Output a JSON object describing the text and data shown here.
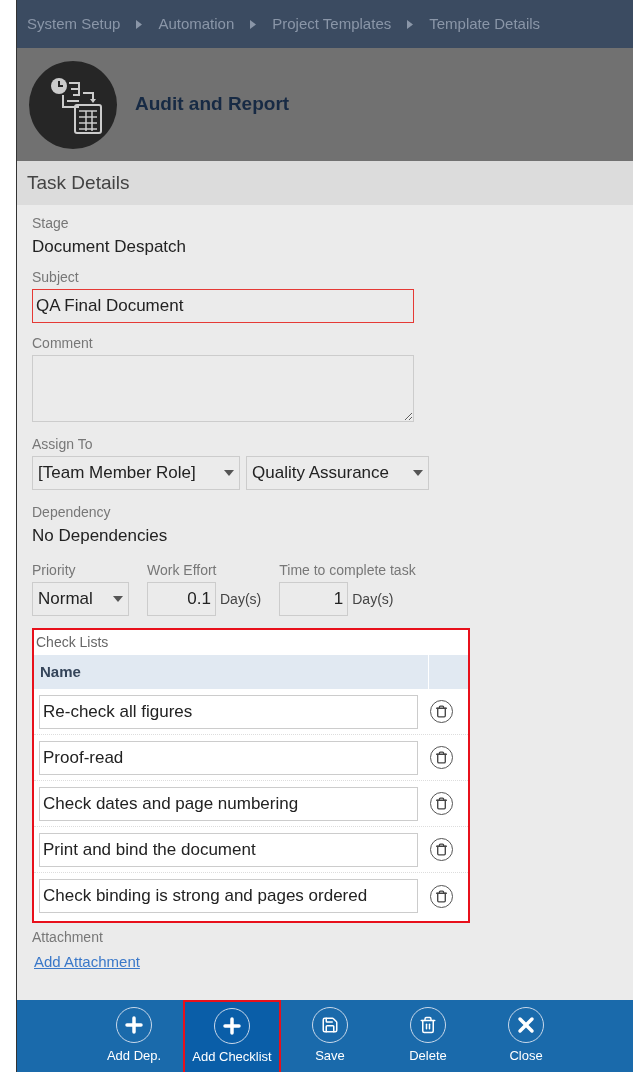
{
  "breadcrumb": [
    {
      "label": "System Setup"
    },
    {
      "label": "Automation"
    },
    {
      "label": "Project Templates"
    },
    {
      "label": "Template Details"
    }
  ],
  "header": {
    "title": "Audit and Report"
  },
  "section_title": "Task Details",
  "stage": {
    "label": "Stage",
    "value": "Document Despatch"
  },
  "subject": {
    "label": "Subject",
    "value": "QA Final Document",
    "highlighted": true
  },
  "comment": {
    "label": "Comment"
  },
  "assign_to": {
    "label": "Assign To",
    "selects": [
      {
        "value": "[Team Member Role]"
      },
      {
        "value": "Quality Assurance"
      }
    ]
  },
  "dependency": {
    "label": "Dependency",
    "value": "No Dependencies"
  },
  "priority": {
    "label": "Priority",
    "value": "Normal"
  },
  "work_effort": {
    "label": "Work Effort",
    "value": "0.1",
    "unit": "Day(s)"
  },
  "time_to_complete": {
    "label": "Time to complete task",
    "value": "1",
    "unit": "Day(s)"
  },
  "check_lists": {
    "label": "Check Lists",
    "highlighted": true,
    "column": "Name",
    "items": [
      {
        "name": "Re-check all figures"
      },
      {
        "name": "Proof-read"
      },
      {
        "name": "Check dates and page numbering"
      },
      {
        "name": "Print and bind the document"
      },
      {
        "name": "Check binding is strong and pages ordered"
      }
    ]
  },
  "attachment": {
    "label": "Attachment",
    "link": "Add Attachment"
  },
  "toolbar": [
    {
      "label": "Add Dep.",
      "kind": "plus",
      "selected": false
    },
    {
      "label": "Add Checklist",
      "kind": "plus",
      "selected": true
    },
    {
      "label": "Save",
      "kind": "save",
      "selected": false
    },
    {
      "label": "Delete",
      "kind": "delete",
      "selected": false
    },
    {
      "label": "Close",
      "kind": "close",
      "selected": false
    }
  ]
}
